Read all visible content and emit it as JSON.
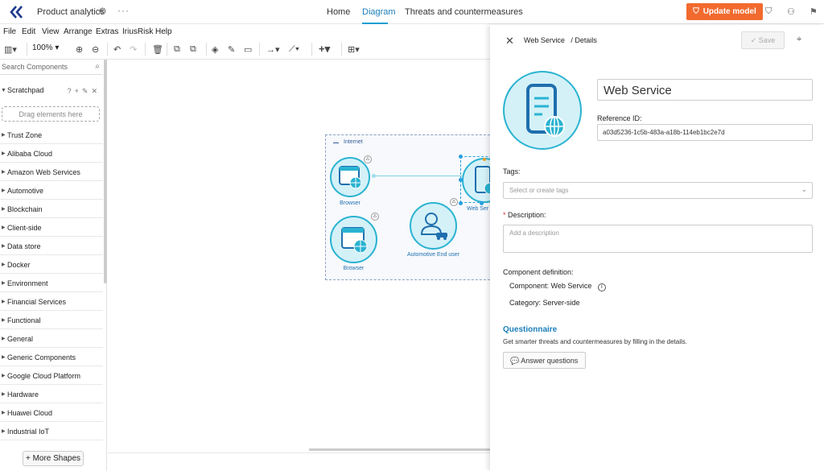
{
  "header": {
    "project": "Product analytics",
    "tabs": [
      {
        "label": "Home"
      },
      {
        "label": "Diagram"
      },
      {
        "label": "Threats and countermeasures"
      }
    ],
    "update_label": "Update model"
  },
  "menu": [
    "File",
    "Edit",
    "View",
    "Arrange",
    "Extras",
    "IriusRisk",
    "Help"
  ],
  "toolbar": {
    "zoom": "100%"
  },
  "sidebar": {
    "search_placeholder": "Search Components",
    "scratchpad": "Scratchpad",
    "drag_hint": "Drag elements here",
    "categories": [
      "Trust Zone",
      "Alibaba Cloud",
      "Amazon Web Services",
      "Automotive",
      "Blockchain",
      "Client-side",
      "Data store",
      "Docker",
      "Environment",
      "Financial Services",
      "Functional",
      "General",
      "Generic Components",
      "Google Cloud Platform",
      "Hardware",
      "Huawei Cloud",
      "Industrial IoT"
    ],
    "more_shapes": "More Shapes"
  },
  "diagram": {
    "zone_label": "Internet",
    "nodes": [
      "Browser",
      "Browser",
      "Automotive End user",
      "Web Ser"
    ]
  },
  "panel": {
    "breadcrumb_name": "Web Service",
    "breadcrumb_section": "/ Details",
    "save_label": "Save",
    "name_value": "Web Service",
    "ref_label": "Reference ID:",
    "ref_value": "a03d5236-1c5b-483a-a18b-114eb1bc2e7d",
    "tags_label": "Tags:",
    "tags_placeholder": "Select or create tags",
    "desc_label": "Description:",
    "desc_placeholder": "Add a description",
    "compdef_label": "Component definition:",
    "component_line": "Component: Web Service",
    "category_line": "Category: Server-side",
    "questionnaire_title": "Questionnaire",
    "questionnaire_desc": "Get smarter threats and countermeasures by filling in the details.",
    "answer_label": "Answer questions"
  }
}
